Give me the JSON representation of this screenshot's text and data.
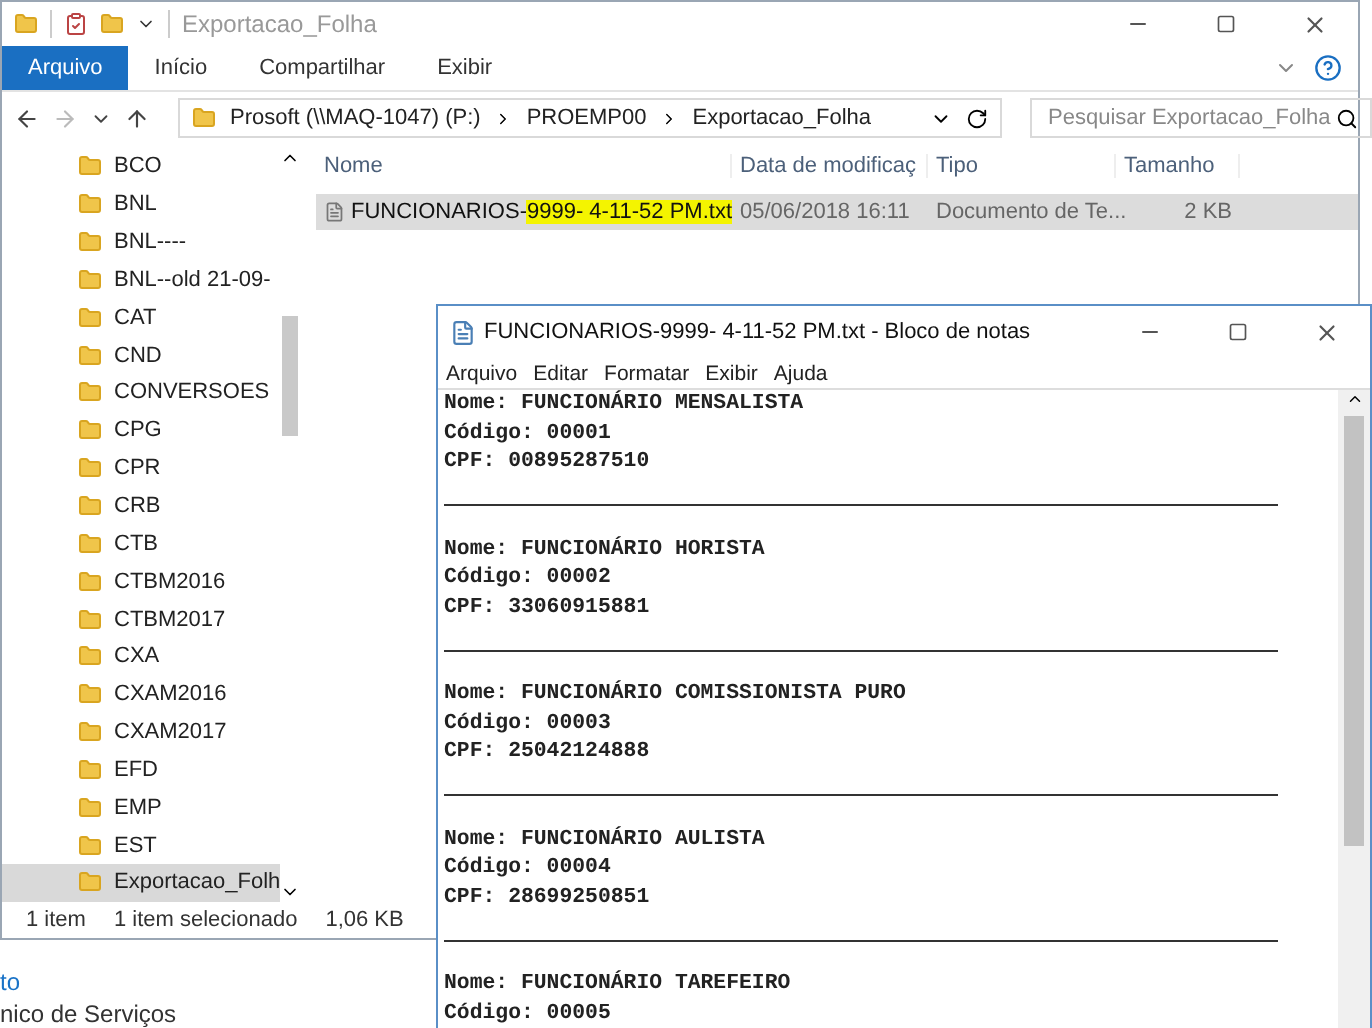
{
  "explorer": {
    "title": "Exportacao_Folha",
    "ribbon_tabs": [
      {
        "label": "Arquivo",
        "selected": true
      },
      {
        "label": "Início",
        "selected": false
      },
      {
        "label": "Compartilhar",
        "selected": false
      },
      {
        "label": "Exibir",
        "selected": false
      }
    ],
    "breadcrumb": [
      "Prosoft (\\\\MAQ-1047) (P:)",
      "PROEMP00",
      "Exportacao_Folha"
    ],
    "search": {
      "placeholder": "Pesquisar Exportacao_Folha"
    },
    "sidebar": {
      "items": [
        {
          "label": "BCO",
          "selected": false
        },
        {
          "label": "BNL",
          "selected": false
        },
        {
          "label": "BNL----",
          "selected": false
        },
        {
          "label": "BNL--old 21-09-",
          "selected": false
        },
        {
          "label": "CAT",
          "selected": false
        },
        {
          "label": "CND",
          "selected": false
        },
        {
          "label": "CONVERSOES",
          "selected": false
        },
        {
          "label": "CPG",
          "selected": false
        },
        {
          "label": "CPR",
          "selected": false
        },
        {
          "label": "CRB",
          "selected": false
        },
        {
          "label": "CTB",
          "selected": false
        },
        {
          "label": "CTBM2016",
          "selected": false
        },
        {
          "label": "CTBM2017",
          "selected": false
        },
        {
          "label": "CXA",
          "selected": false
        },
        {
          "label": "CXAM2016",
          "selected": false
        },
        {
          "label": "CXAM2017",
          "selected": false
        },
        {
          "label": "EFD",
          "selected": false
        },
        {
          "label": "EMP",
          "selected": false
        },
        {
          "label": "EST",
          "selected": false
        },
        {
          "label": "Exportacao_Folh",
          "selected": true
        }
      ]
    },
    "columns": [
      "Nome",
      "Data de modificaç",
      "Tipo",
      "Tamanho"
    ],
    "files": [
      {
        "name_parts": [
          {
            "text": "FUNCIONARIOS-",
            "highlighted": false
          },
          {
            "text": "9999- 4-11-52 PM.txt",
            "highlighted": true
          }
        ],
        "modified": "05/06/2018 16:11",
        "type": "Documento de Te...",
        "size": "2 KB",
        "selected": true
      }
    ],
    "status_bar": [
      "1 item",
      "1 item selecionado",
      "1,06 KB"
    ]
  },
  "notepad": {
    "title": "FUNCIONARIOS-9999- 4-11-52 PM.txt - Bloco de notas",
    "menu": [
      "Arquivo",
      "Editar",
      "Formatar",
      "Exibir",
      "Ajuda"
    ],
    "lines": [
      {
        "kind": "text",
        "text": "Nome: FUNCIONÁRIO MENSALISTA"
      },
      {
        "kind": "text",
        "text": "Código: 00001"
      },
      {
        "kind": "text",
        "text": "CPF: 00895287510"
      },
      {
        "kind": "rule"
      },
      {
        "kind": "blank"
      },
      {
        "kind": "text",
        "text": "Nome: FUNCIONÁRIO HORISTA"
      },
      {
        "kind": "text",
        "text": "Código: 00002"
      },
      {
        "kind": "text",
        "text": "CPF: 33060915881"
      },
      {
        "kind": "rule"
      },
      {
        "kind": "blank"
      },
      {
        "kind": "text",
        "text": "Nome: FUNCIONÁRIO COMISSIONISTA PURO"
      },
      {
        "kind": "text",
        "text": "Código: 00003"
      },
      {
        "kind": "text",
        "text": "CPF: 25042124888"
      },
      {
        "kind": "rule"
      },
      {
        "kind": "blank"
      },
      {
        "kind": "text",
        "text": "Nome: FUNCIONÁRIO AULISTA"
      },
      {
        "kind": "text",
        "text": "Código: 00004"
      },
      {
        "kind": "text",
        "text": "CPF: 28699250851"
      },
      {
        "kind": "rule"
      },
      {
        "kind": "blank"
      },
      {
        "kind": "text",
        "text": "Nome: FUNCIONÁRIO TAREFEIRO"
      },
      {
        "kind": "text",
        "text": "Código: 00005"
      }
    ]
  },
  "background": {
    "lines": [
      {
        "kind": "link",
        "text": "to"
      },
      {
        "kind": "plain",
        "text": "nico de Serviços"
      }
    ]
  }
}
